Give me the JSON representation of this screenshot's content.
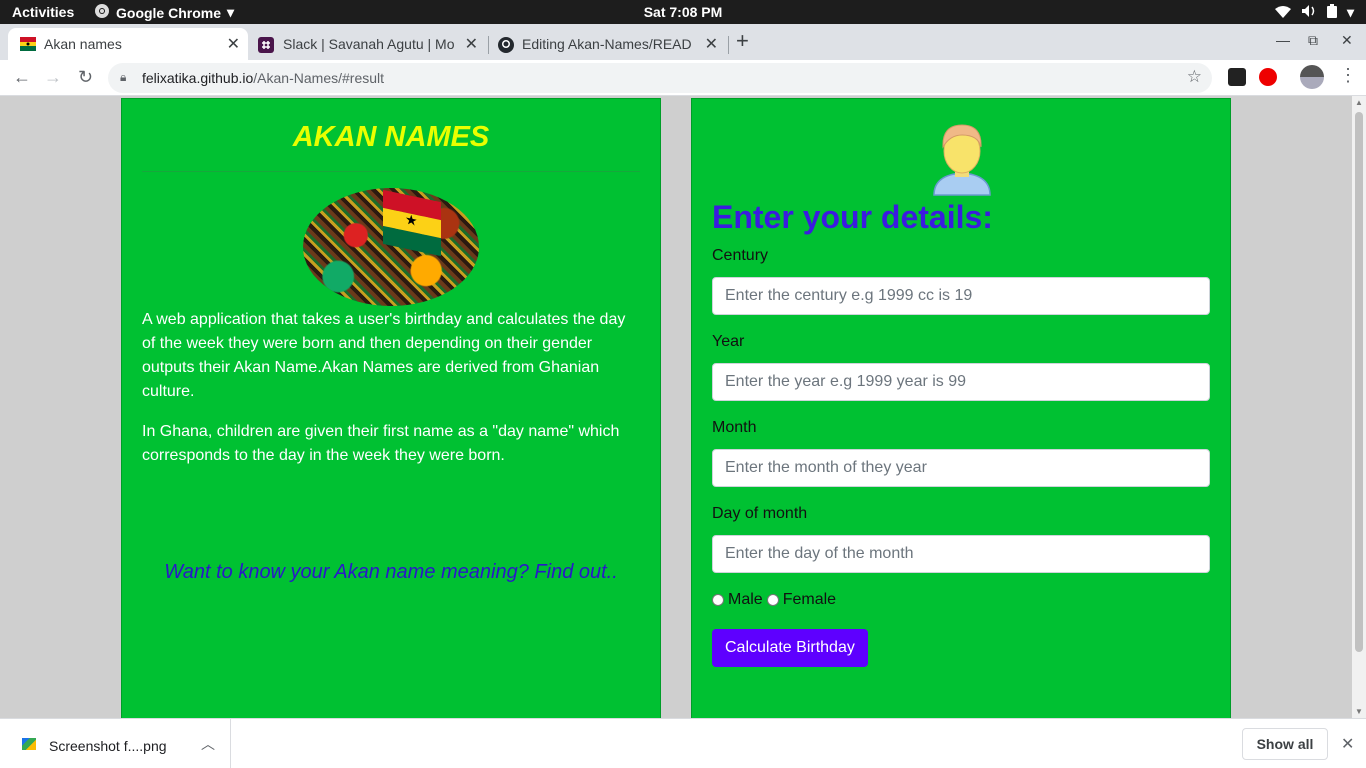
{
  "system": {
    "activities": "Activities",
    "app_name": "Google Chrome",
    "clock": "Sat  7:08 PM"
  },
  "browser": {
    "tabs": [
      {
        "title": "Akan names",
        "icon": "ghana-flag-icon",
        "active": true
      },
      {
        "title": "Slack | Savanah Agutu | Mo",
        "icon": "slack-icon",
        "active": false
      },
      {
        "title": "Editing Akan-Names/READ",
        "icon": "github-icon",
        "active": false
      }
    ],
    "url_host": "felixatika.github.io",
    "url_path": "/Akan-Names/#result"
  },
  "page": {
    "title": "AKAN NAMES",
    "description_1": "A web application that takes a user's birthday and calculates the day of the week they were born and then depending on their gender outputs their Akan Name.Akan Names are derived from Ghanian culture.",
    "description_2": "In Ghana, children are given their first name as a \"day name\" which corresponds to the day in the week they were born.",
    "cta": "Want to know your Akan name meaning? Find out..",
    "form": {
      "heading": "Enter your details:",
      "century_label": "Century",
      "century_placeholder": "Enter the century e.g 1999 cc is 19",
      "year_label": "Year",
      "year_placeholder": "Enter the year e.g 1999 year is 99",
      "month_label": "Month",
      "month_placeholder": "Enter the month of they year",
      "day_label": "Day of month",
      "day_placeholder": "Enter the day of the month",
      "gender_male": "Male",
      "gender_female": "Female",
      "submit_label": "Calculate Birthday"
    }
  },
  "downloads": {
    "file_name": "Screenshot f....png",
    "show_all_label": "Show all"
  },
  "colors": {
    "panel_green": "#00c132",
    "title_yellow": "#eaff00",
    "heading_blue": "#3b1be0",
    "button_purple": "#5e00ff"
  }
}
